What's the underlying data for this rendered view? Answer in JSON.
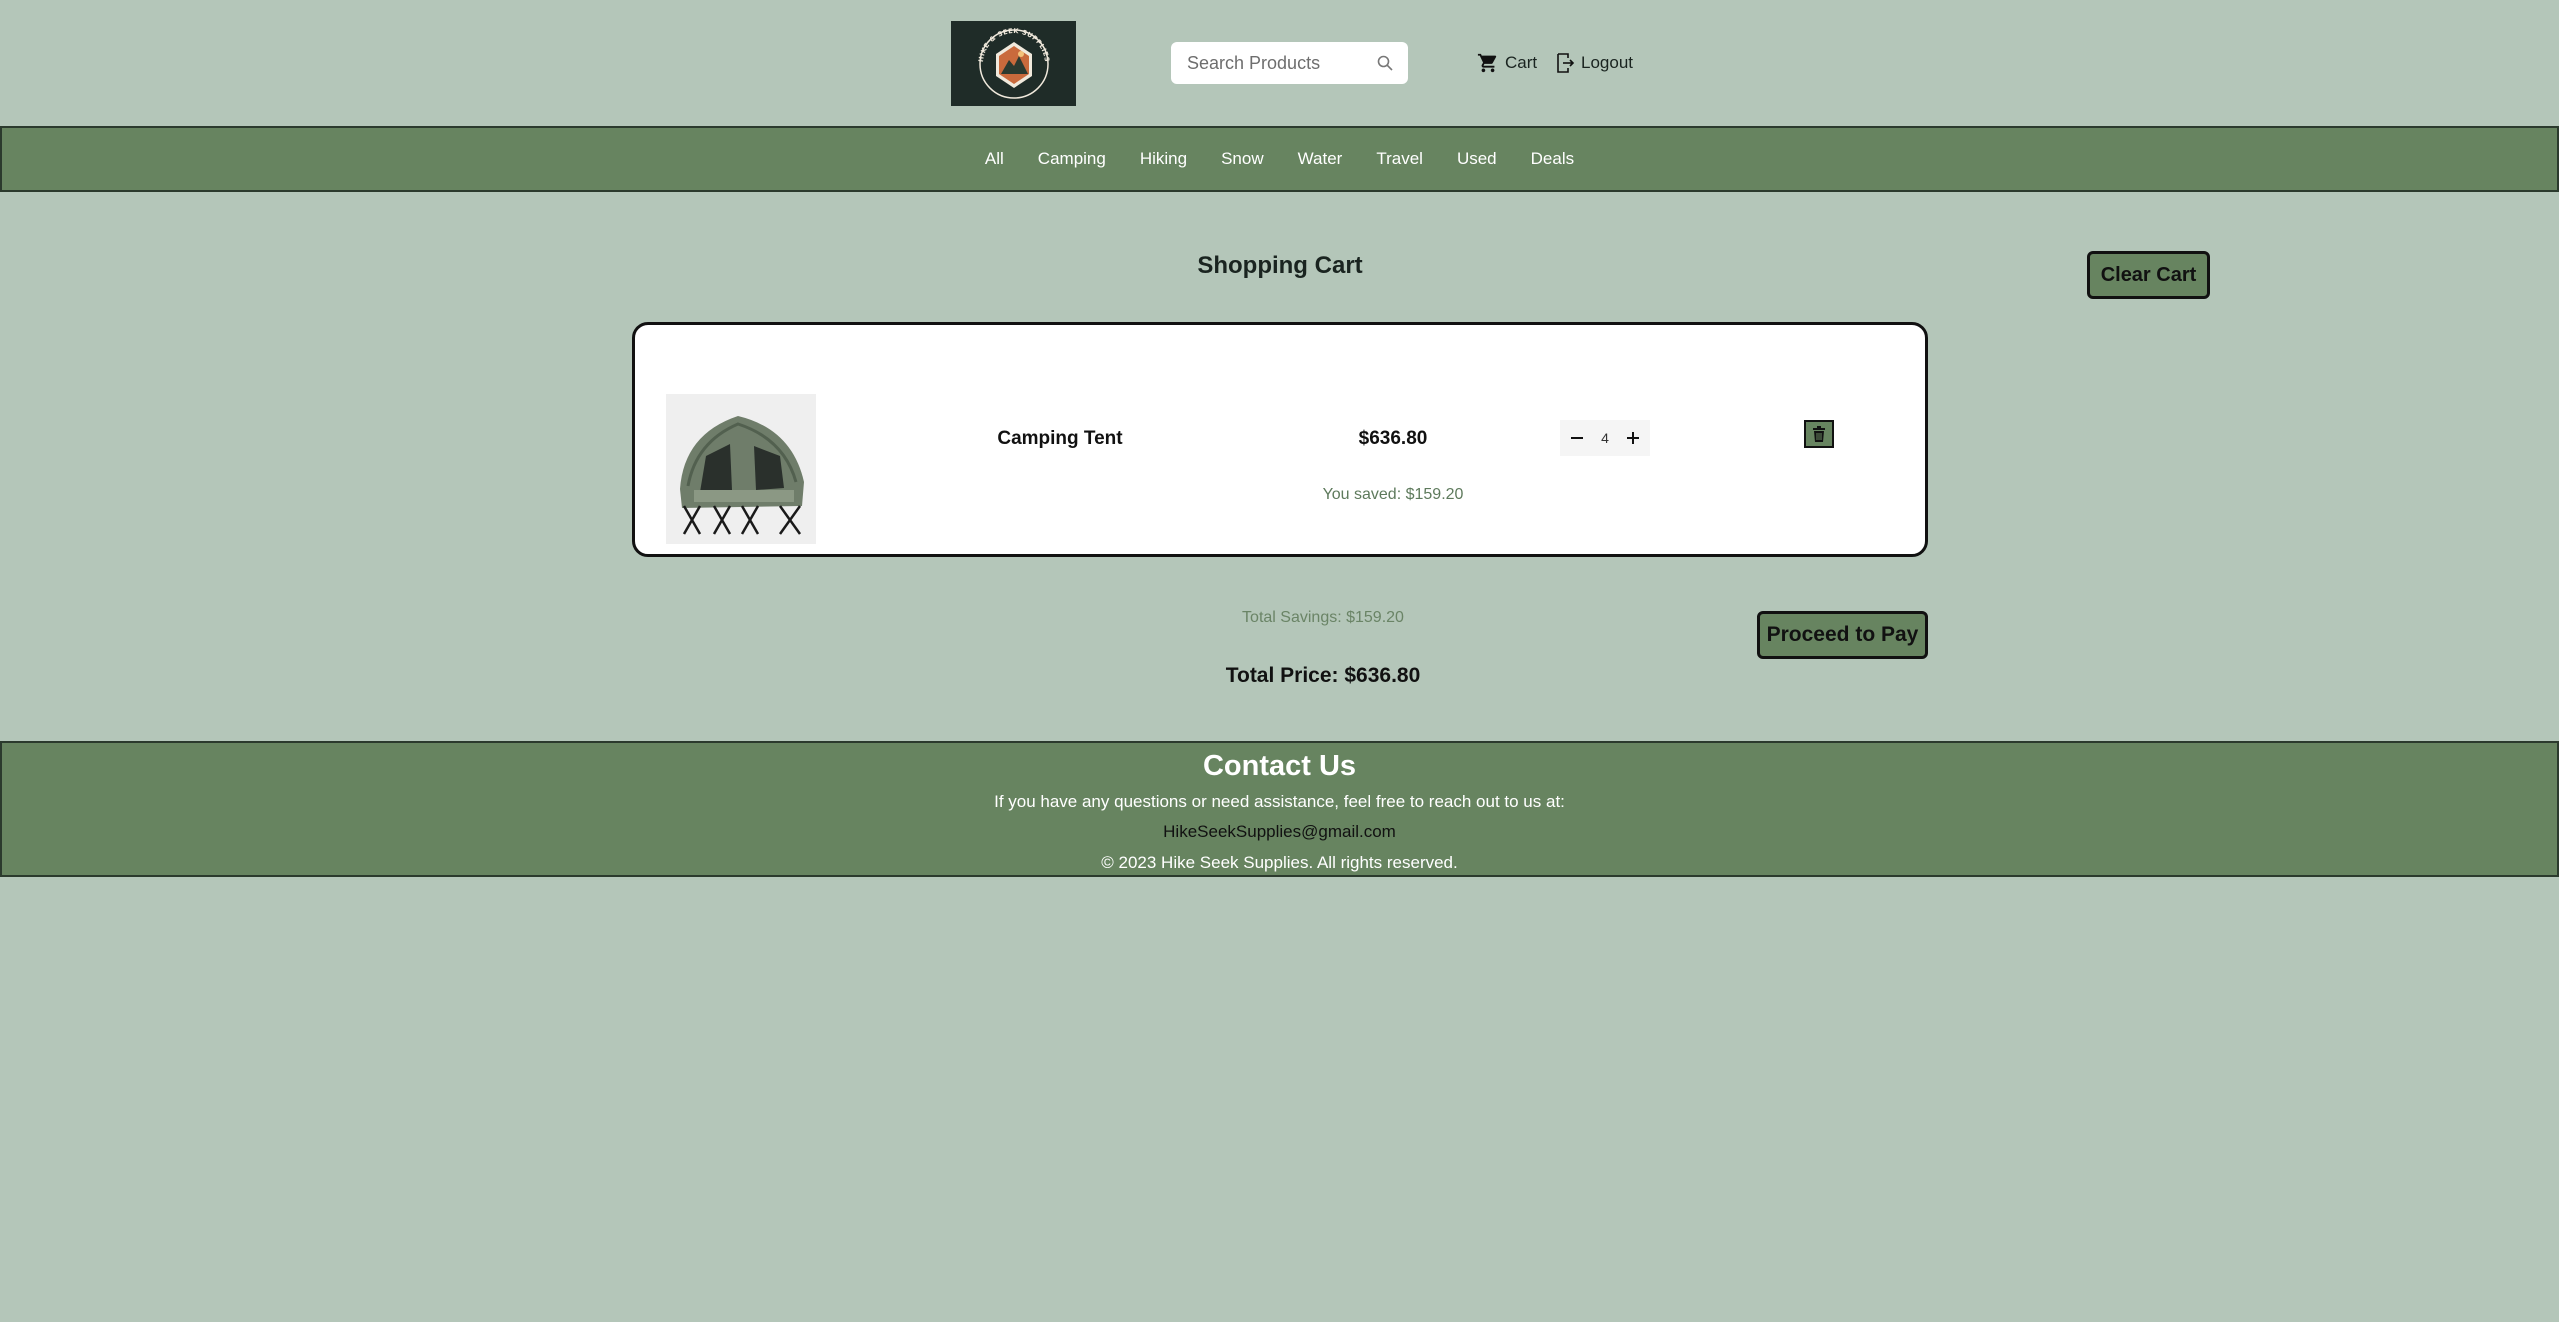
{
  "header": {
    "logo_text": "HIKE & SEEK SUPPLIES",
    "search_placeholder": "Search Products",
    "cart_label": "Cart",
    "logout_label": "Logout"
  },
  "nav": {
    "items": [
      "All",
      "Camping",
      "Hiking",
      "Snow",
      "Water",
      "Travel",
      "Used",
      "Deals"
    ]
  },
  "main": {
    "title": "Shopping Cart",
    "clear_cart_label": "Clear Cart",
    "items": [
      {
        "name": "Camping Tent",
        "price": "$636.80",
        "quantity": "4",
        "saved": "You saved: $159.20"
      }
    ],
    "total_savings": "Total Savings: $159.20",
    "total_price": "Total Price: $636.80",
    "proceed_label": "Proceed to Pay"
  },
  "footer": {
    "heading": "Contact Us",
    "message": "If you have any questions or need assistance, feel free to reach out to us at:",
    "email": "HikeSeekSupplies@gmail.com",
    "copyright": "© 2023 Hike Seek Supplies. All rights reserved."
  },
  "colors": {
    "background": "#b4c6b9",
    "accent_green": "#678460",
    "logo_bg": "#1f2c28"
  },
  "icons": [
    "search-icon",
    "cart-icon",
    "logout-icon",
    "minus-icon",
    "plus-icon",
    "trash-icon"
  ]
}
